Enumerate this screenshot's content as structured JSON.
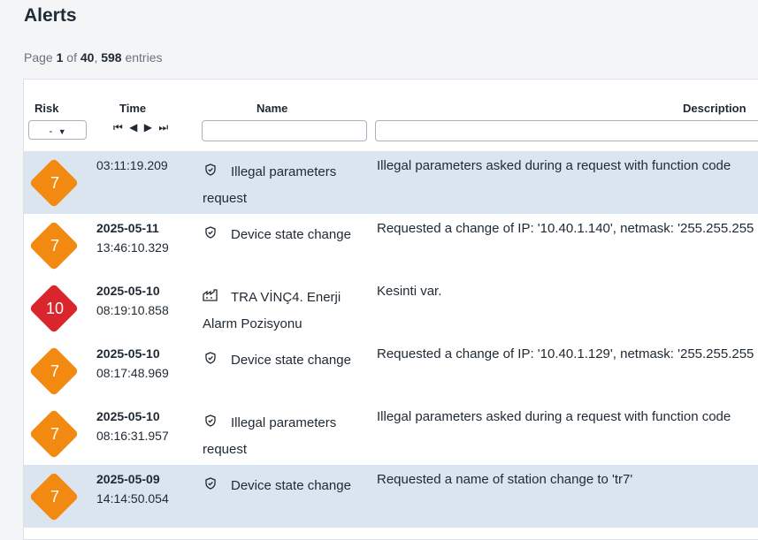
{
  "page": {
    "title": "Alerts"
  },
  "pager": {
    "prefix": "Page",
    "current": "1",
    "of": "of",
    "total": "40",
    "sep": ",",
    "entries_count": "598",
    "entries_label": "entries"
  },
  "table": {
    "headers": {
      "risk": "Risk",
      "time": "Time",
      "name": "Name",
      "description": "Description"
    },
    "risk_filter_value": "-",
    "nav": {
      "first": "⏮",
      "prev": "◀",
      "next": "▶",
      "last": "⏭"
    }
  },
  "colors": {
    "orange": "#f28a12",
    "red": "#d9262c",
    "selected_row": "#dbe5ef"
  },
  "rows": [
    {
      "risk": "7",
      "color": "#f28a12",
      "date": "",
      "time": "03:11:19.209",
      "icon": "shield-icon",
      "name": "Illegal parameters request",
      "description": "Illegal parameters asked during a request with function code",
      "selected": true
    },
    {
      "risk": "7",
      "color": "#f28a12",
      "date": "2025-05-11",
      "time": "13:46:10.329",
      "icon": "shield-icon",
      "name": "Device state change",
      "description": "Requested a change of IP: '10.40.1.140', netmask: '255.255.255",
      "selected": false
    },
    {
      "risk": "10",
      "color": "#d9262c",
      "date": "2025-05-10",
      "time": "08:19:10.858",
      "icon": "factory-icon",
      "name": "TRA VİNÇ4. Enerji Alarm Pozisyonu",
      "description": "Kesinti var.",
      "selected": false
    },
    {
      "risk": "7",
      "color": "#f28a12",
      "date": "2025-05-10",
      "time": "08:17:48.969",
      "icon": "shield-icon",
      "name": "Device state change",
      "description": "Requested a change of IP: '10.40.1.129', netmask: '255.255.255",
      "selected": false
    },
    {
      "risk": "7",
      "color": "#f28a12",
      "date": "2025-05-10",
      "time": "08:16:31.957",
      "icon": "shield-icon",
      "name": "Illegal parameters request",
      "description": "Illegal parameters asked during a request with function code",
      "selected": false
    },
    {
      "risk": "7",
      "color": "#f28a12",
      "date": "2025-05-09",
      "time": "14:14:50.054",
      "icon": "shield-icon",
      "name": "Device state change",
      "description": "Requested a name of station change to 'tr7'",
      "selected": true
    }
  ]
}
